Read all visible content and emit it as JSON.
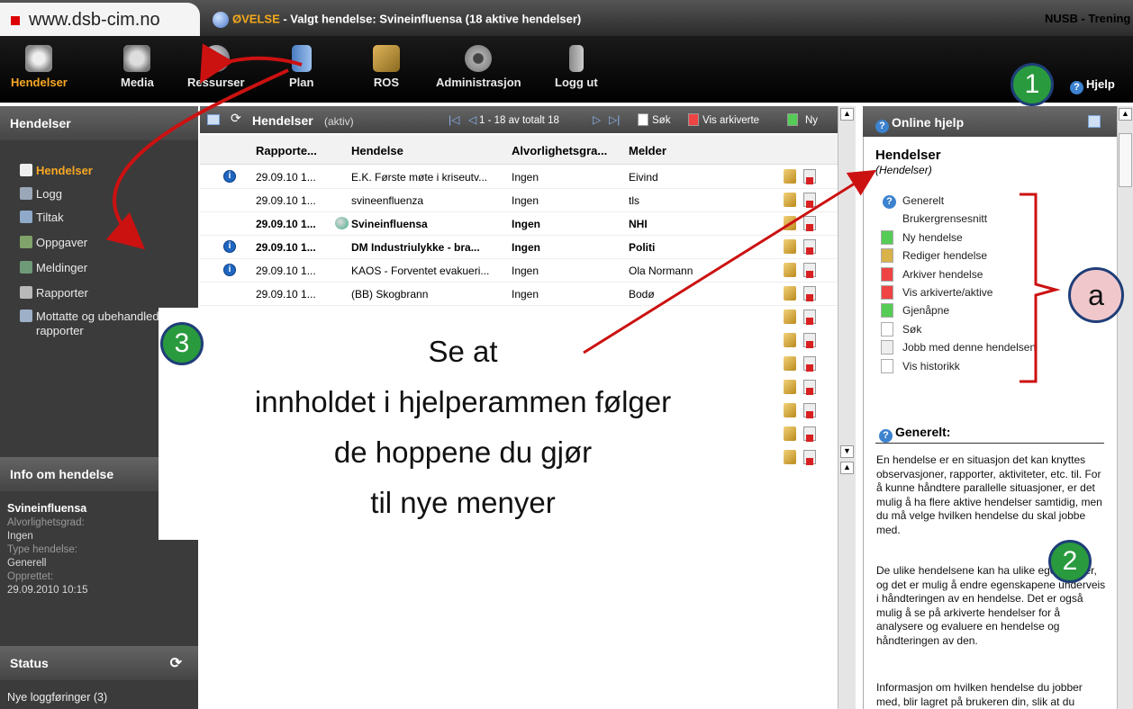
{
  "top": {
    "url": "www.dsb-cim.no",
    "exercise_tag": "ØVELSE",
    "selected_event_text": " - Valgt hendelse: Svineinfluensa (18 aktive hendelser)",
    "right_label": "NUSB - Trening"
  },
  "menu": {
    "items": [
      {
        "label": "Hendelser",
        "icon": "gauge-icon"
      },
      {
        "label": "Media",
        "icon": "clock-icon"
      },
      {
        "label": "Ressurser",
        "icon": "globe-icon"
      },
      {
        "label": "Plan",
        "icon": "book-icon"
      },
      {
        "label": "ROS",
        "icon": "blocks-icon"
      },
      {
        "label": "Administrasjon",
        "icon": "gear-icon"
      },
      {
        "label": "Logg ut",
        "icon": "door-icon"
      }
    ],
    "help_label": "Hjelp"
  },
  "left": {
    "title": "Hendelser",
    "nav": [
      "Hendelser",
      "Logg",
      "Tiltak",
      "Oppgaver",
      "Meldinger",
      "Rapporter",
      "Mottatte og ubehandlede",
      "rapporter"
    ],
    "info_title": "Info om hendelse",
    "info": {
      "name": "Svineinfluensa",
      "severity_label": "Alvorlighetsgrad:",
      "severity": "Ingen",
      "type_label": "Type hendelse:",
      "type": "Generell",
      "created_label": "Opprettet:",
      "created": "29.09.2010 10:15"
    },
    "status_title": "Status",
    "status_item": "Nye loggføringer (3)"
  },
  "center": {
    "title": "Hendelser",
    "title_suffix": "(aktiv)",
    "pager": "1 - 18 av totalt 18",
    "search": "Søk",
    "show_archived": "Vis arkiverte",
    "new": "Ny",
    "columns": [
      "Rapporte...",
      "Hendelse",
      "Alvorlighetsgra...",
      "Melder"
    ],
    "rows": [
      {
        "date": "29.09.10 1...",
        "event": "E.K. Første møte i kriseutv...",
        "severity": "Ingen",
        "reporter": "Eivind",
        "bold": false,
        "info": true
      },
      {
        "date": "29.09.10 1...",
        "event": "svineenfluenza",
        "severity": "Ingen",
        "reporter": "tls",
        "bold": false,
        "info": false
      },
      {
        "date": "29.09.10 1...",
        "event": "Svineinfluensa",
        "severity": "Ingen",
        "reporter": "NHI",
        "bold": true,
        "info": false
      },
      {
        "date": "29.09.10 1...",
        "event": "DM Industriulykke - bra...",
        "severity": "Ingen",
        "reporter": "Politi",
        "bold": true,
        "info": true
      },
      {
        "date": "29.09.10 1...",
        "event": "KAOS - Forventet evakueri...",
        "severity": "Ingen",
        "reporter": "Ola Normann",
        "bold": false,
        "info": true
      },
      {
        "date": "29.09.10 1...",
        "event": "(BB) Skogbrann",
        "severity": "Ingen",
        "reporter": "Bodø",
        "bold": false,
        "info": false
      }
    ]
  },
  "help": {
    "header": "Online hjelp",
    "title": "Hendelser",
    "subtitle": "(Hendelser)",
    "links": [
      "Generelt",
      "Brukergrensesnitt",
      "Ny hendelse",
      "Rediger hendelse",
      "Arkiver hendelse",
      "Vis arkiverte/aktive",
      "Gjenåpne",
      "Søk",
      "Jobb med denne hendelsen",
      "Vis historikk"
    ],
    "section_title": "Generelt:",
    "p1": "En hendelse er en situasjon det kan knyttes observasjoner, rapporter, aktiviteter, etc. til. For å kunne håndtere parallelle situasjoner, er det mulig å ha flere aktive hendelser samtidig, men du må velge hvilken hendelse du skal jobbe med.",
    "p2": "De ulike hendelsene kan ha ulike egenskaper, og det er mulig å endre egenskapene underveis i håndteringen av en hendelse. Det er også mulig å se på arkiverte hendelser for å analysere og evaluere en hendelse og håndteringen av den.",
    "p3": "Informasjon om hvilken hendelse du jobber med, blir lagret på brukeren din, slik at du"
  },
  "callout": {
    "lines": [
      "Se at",
      "innholdet i hjelperammen følger",
      "de hoppene du gjør",
      "til nye menyer"
    ],
    "badge1": "1",
    "badge2": "2",
    "badge3": "3",
    "badge_a": "a"
  },
  "colors": {
    "accent": "#f7a823",
    "badge_green": "#2a9a3e",
    "arrow_red": "#cc1111"
  }
}
